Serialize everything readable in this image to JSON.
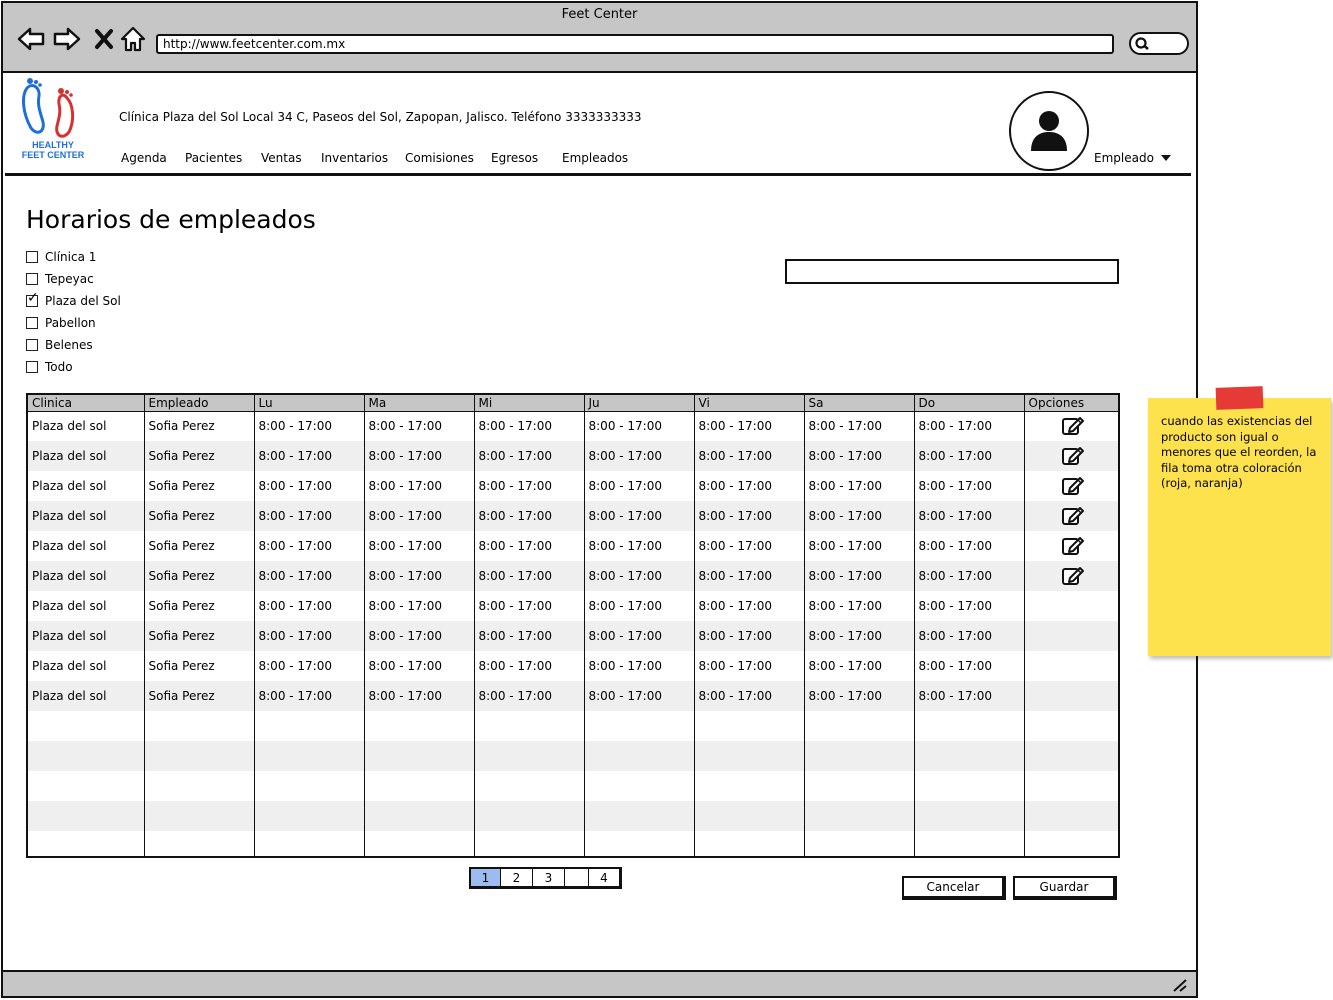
{
  "browser": {
    "title": "Feet Center",
    "url": "http://www.feetcenter.com.mx"
  },
  "header": {
    "logo_text": "HEALTHY FEET CENTER",
    "address": "Clínica Plaza del Sol Local 34 C, Paseos del Sol, Zapopan, Jalisco. Teléfono 3333333333",
    "menu": [
      "Agenda",
      "Pacientes",
      "Ventas",
      "Inventarios",
      "Comisiones",
      "Egresos",
      "Empleados"
    ],
    "user_menu": "Empleado"
  },
  "page": {
    "title": "Horarios de empleados"
  },
  "filters": [
    {
      "label": "Clínica 1",
      "checked": false
    },
    {
      "label": "Tepeyac",
      "checked": false
    },
    {
      "label": "Plaza del Sol",
      "checked": true
    },
    {
      "label": "Pabellon",
      "checked": false
    },
    {
      "label": "Belenes",
      "checked": false
    },
    {
      "label": "Todo",
      "checked": false
    }
  ],
  "table": {
    "columns": [
      "Clinica",
      "Empleado",
      "Lu",
      "Ma",
      "Mi",
      "Ju",
      "Vi",
      "Sa",
      "Do",
      "Opciones"
    ],
    "rows": [
      {
        "cells": [
          "Plaza del sol",
          "Sofia Perez",
          "8:00 - 17:00",
          "8:00 - 17:00",
          "8:00 - 17:00",
          "8:00 - 17:00",
          "8:00 - 17:00",
          "8:00 - 17:00",
          "8:00 - 17:00"
        ],
        "edit": true
      },
      {
        "cells": [
          "Plaza del sol",
          "Sofia Perez",
          "8:00 - 17:00",
          "8:00 - 17:00",
          "8:00 - 17:00",
          "8:00 - 17:00",
          "8:00 - 17:00",
          "8:00 - 17:00",
          "8:00 - 17:00"
        ],
        "edit": true
      },
      {
        "cells": [
          "Plaza del sol",
          "Sofia Perez",
          "8:00 - 17:00",
          "8:00 - 17:00",
          "8:00 - 17:00",
          "8:00 - 17:00",
          "8:00 - 17:00",
          "8:00 - 17:00",
          "8:00 - 17:00"
        ],
        "edit": true
      },
      {
        "cells": [
          "Plaza del sol",
          "Sofia Perez",
          "8:00 - 17:00",
          "8:00 - 17:00",
          "8:00 - 17:00",
          "8:00 - 17:00",
          "8:00 - 17:00",
          "8:00 - 17:00",
          "8:00 - 17:00"
        ],
        "edit": true
      },
      {
        "cells": [
          "Plaza del sol",
          "Sofia Perez",
          "8:00 - 17:00",
          "8:00 - 17:00",
          "8:00 - 17:00",
          "8:00 - 17:00",
          "8:00 - 17:00",
          "8:00 - 17:00",
          "8:00 - 17:00"
        ],
        "edit": true
      },
      {
        "cells": [
          "Plaza del sol",
          "Sofia Perez",
          "8:00 - 17:00",
          "8:00 - 17:00",
          "8:00 - 17:00",
          "8:00 - 17:00",
          "8:00 - 17:00",
          "8:00 - 17:00",
          "8:00 - 17:00"
        ],
        "edit": true
      },
      {
        "cells": [
          "Plaza del sol",
          "Sofia Perez",
          "8:00 - 17:00",
          "8:00 - 17:00",
          "8:00 - 17:00",
          "8:00 - 17:00",
          "8:00 - 17:00",
          "8:00 - 17:00",
          "8:00 - 17:00"
        ],
        "edit": false
      },
      {
        "cells": [
          "Plaza del sol",
          "Sofia Perez",
          "8:00 - 17:00",
          "8:00 - 17:00",
          "8:00 - 17:00",
          "8:00 - 17:00",
          "8:00 - 17:00",
          "8:00 - 17:00",
          "8:00 - 17:00"
        ],
        "edit": false
      },
      {
        "cells": [
          "Plaza del sol",
          "Sofia Perez",
          "8:00 - 17:00",
          "8:00 - 17:00",
          "8:00 - 17:00",
          "8:00 - 17:00",
          "8:00 - 17:00",
          "8:00 - 17:00",
          "8:00 - 17:00"
        ],
        "edit": false
      },
      {
        "cells": [
          "Plaza del sol",
          "Sofia Perez",
          "8:00 - 17:00",
          "8:00 - 17:00",
          "8:00 - 17:00",
          "8:00 - 17:00",
          "8:00 - 17:00",
          "8:00 - 17:00",
          "8:00 - 17:00"
        ],
        "edit": false
      },
      {
        "cells": [
          "",
          "",
          "",
          "",
          "",
          "",
          "",
          "",
          ""
        ],
        "edit": false
      },
      {
        "cells": [
          "",
          "",
          "",
          "",
          "",
          "",
          "",
          "",
          ""
        ],
        "edit": false
      },
      {
        "cells": [
          "",
          "",
          "",
          "",
          "",
          "",
          "",
          "",
          ""
        ],
        "edit": false
      },
      {
        "cells": [
          "",
          "",
          "",
          "",
          "",
          "",
          "",
          "",
          ""
        ],
        "edit": false
      },
      {
        "cells": [
          "",
          "",
          "",
          "",
          "",
          "",
          "",
          "",
          ""
        ],
        "edit": false
      }
    ]
  },
  "pagination": {
    "pages": [
      "1",
      "2",
      "3",
      "",
      "4"
    ],
    "active": "1"
  },
  "buttons": {
    "cancel": "Cancelar",
    "save": "Guardar"
  },
  "sticky_note": {
    "text": "cuando las existencias del producto son igual o menores que el reorden, la fila toma otra coloración (roja, naranja)"
  },
  "colors": {
    "chrome": "#c6c6c6",
    "active_page": "#9dbbee",
    "sticky": "#fde14d",
    "tape": "#e63a36",
    "logo_blue": "#1f6fd8"
  }
}
